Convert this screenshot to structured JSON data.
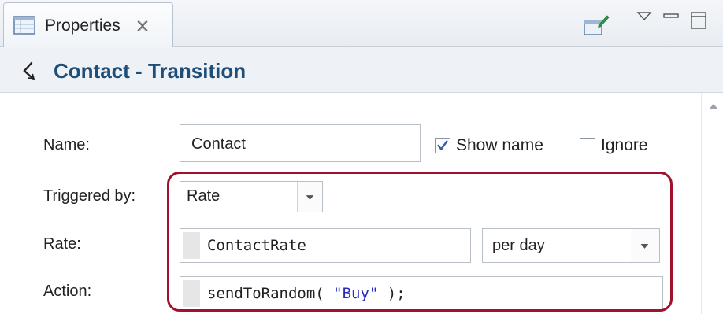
{
  "tab": {
    "label": "Properties",
    "icon": "properties-icon",
    "close_icon": "close-icon"
  },
  "toolbar": {
    "icons": [
      "new-view-icon",
      "view-menu-icon",
      "minimize-icon",
      "maximize-icon"
    ]
  },
  "header": {
    "title": "Contact - Transition",
    "icon": "transition-icon"
  },
  "form": {
    "name": {
      "label": "Name:",
      "value": "Contact"
    },
    "show_name": {
      "label": "Show name",
      "checked": true
    },
    "ignore": {
      "label": "Ignore",
      "checked": false
    },
    "triggered_by": {
      "label": "Triggered by:",
      "value": "Rate"
    },
    "rate": {
      "label": "Rate:",
      "value": "ContactRate",
      "unit": "per day"
    },
    "action": {
      "label": "Action:",
      "code_func": "sendToRandom( ",
      "code_str": "\"Buy\"",
      "code_end": " );"
    }
  },
  "colors": {
    "title": "#1f4e79",
    "highlight": "#a0122b",
    "string_literal": "#2a2ac0"
  }
}
